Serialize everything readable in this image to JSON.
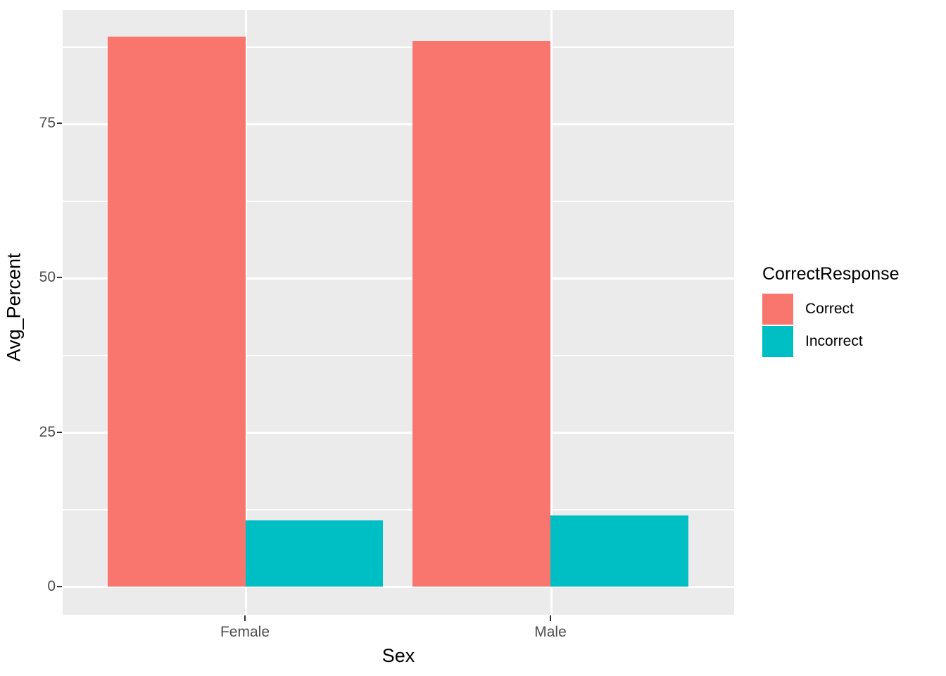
{
  "chart_data": {
    "type": "bar",
    "title": "",
    "subtitle": "",
    "xlabel": "Sex",
    "ylabel": "Avg_Percent",
    "categories": [
      "Female",
      "Male"
    ],
    "series": [
      {
        "name": "Correct",
        "color": "#F8766D",
        "values": [
          89.0,
          88.3
        ]
      },
      {
        "name": "Incorrect",
        "color": "#00BFC4",
        "values": [
          10.7,
          11.5
        ]
      }
    ],
    "legend": {
      "title": "CorrectResponse",
      "position": "right",
      "entries": [
        {
          "label": "Correct",
          "color": "#F8766D"
        },
        {
          "label": "Incorrect",
          "color": "#00BFC4"
        }
      ]
    },
    "yaxis": {
      "ticks": [
        0,
        25,
        50,
        75
      ],
      "tick_labels": [
        "0",
        "25",
        "50",
        "75"
      ],
      "minor_ticks": [
        12.5,
        37.5,
        62.5,
        87.5
      ],
      "ylim": [
        -2.8,
        95.0
      ]
    },
    "xaxis": {
      "tick_labels": [
        "Female",
        "Male"
      ]
    },
    "grid": {
      "major_color": "#FFFFFF",
      "minor_color": "#FFFFFF",
      "panel_background": "#EBEBEB",
      "show_x_major": true,
      "show_y_major": true,
      "show_y_minor": true
    },
    "style": "ggplot2-theme-grey",
    "position": "dodge"
  }
}
